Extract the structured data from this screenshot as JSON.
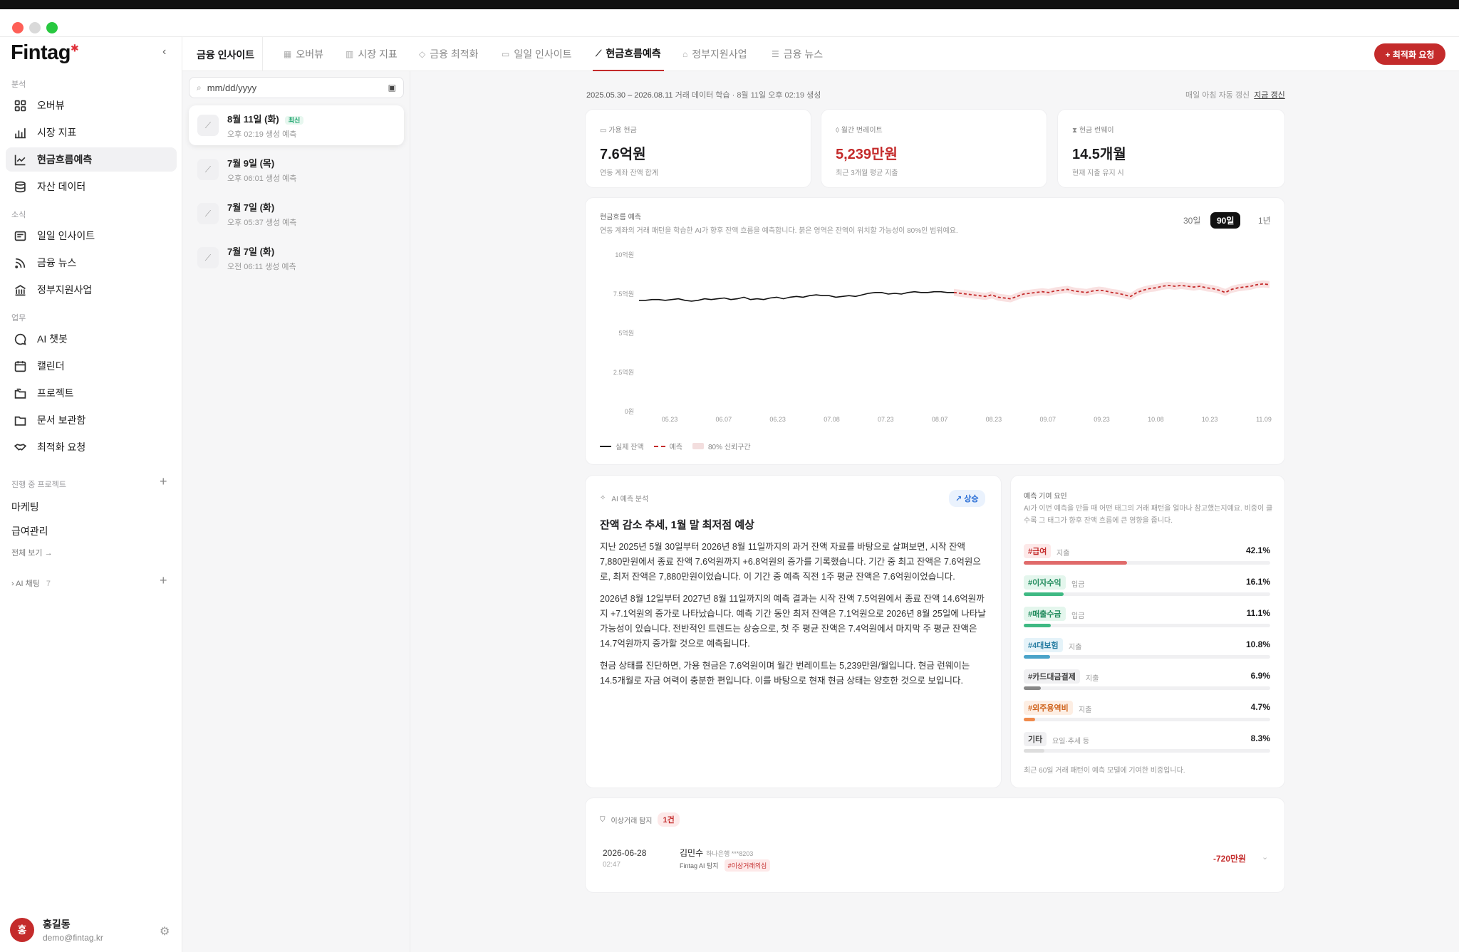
{
  "sidebar": {
    "logo": "Fintag",
    "sections": {
      "analysis": "분석",
      "news": "소식",
      "work": "업무",
      "projects": "진행 중 프로젝트"
    },
    "analysis_items": [
      "오버뷰",
      "시장 지표",
      "현금흐름예측",
      "자산 데이터"
    ],
    "news_items": [
      "일일 인사이트",
      "금융 뉴스",
      "정부지원사업"
    ],
    "work_items": [
      "AI 챗봇",
      "캘린더",
      "프로젝트",
      "문서 보관함",
      "최적화 요청"
    ],
    "projects": [
      "마케팅",
      "급여관리"
    ],
    "see_all": "전체 보기 →",
    "ai_chat": "AI 채팅",
    "ai_chat_count": "7",
    "user": {
      "initial": "홍",
      "name": "홍길동",
      "email": "demo@fintag.kr"
    }
  },
  "header": {
    "title": "금융 인사이트",
    "tabs": [
      "오버뷰",
      "시장 지표",
      "금융 최적화",
      "일일 인사이트",
      "현금흐름예측",
      "정부지원사업",
      "금융 뉴스"
    ],
    "active_tab": "현금흐름예측",
    "request_button": "+ 최적화 요청"
  },
  "reports": {
    "date_placeholder": "mm/dd/yyyy",
    "items": [
      {
        "title": "8월 11일 (화)",
        "sub": "오후 02:19 생성 예측",
        "badge": "최신"
      },
      {
        "title": "7월 9일 (목)",
        "sub": "오후 06:01 생성 예측"
      },
      {
        "title": "7월 7일 (화)",
        "sub": "오후 05:37 생성 예측"
      },
      {
        "title": "7월 7일 (화)",
        "sub": "오전 06:11 생성 예측"
      }
    ]
  },
  "meta": {
    "period": "2025.05.30 – 2026.08.11",
    "detail": " 거래 데이터 학습 · 8월 11일 오후 02:19 생성",
    "auto": "매일 아침 자동 갱신",
    "refresh": "지금 갱신"
  },
  "kpis": [
    {
      "label": "가용 현금",
      "value": "7.6억원",
      "sub": "연동 계좌 잔액 합계",
      "color": "#1c1c1e"
    },
    {
      "label": "월간 번레이트",
      "value": "5,239만원",
      "sub": "최근 3개월 평균 지출",
      "color": "#c42b2b"
    },
    {
      "label": "현금 런웨이",
      "value": "14.5개월",
      "sub": "현재 지출 유지 시",
      "color": "#1c1c1e"
    }
  ],
  "forecast": {
    "title": "현금흐름 예측",
    "desc": "연동 계좌의 거래 패턴을 학습한 AI가 향후 잔액 흐름을 예측합니다. 붉은 영역은 잔액이 위치할 가능성이 80%인 범위예요.",
    "ranges": [
      "30일",
      "90일",
      "1년"
    ],
    "active_range": "90일",
    "legend": [
      "실제 잔액",
      "예측",
      "80% 신뢰구간"
    ]
  },
  "chart_data": {
    "type": "line",
    "y_ticks": [
      "10억원",
      "7.5억원",
      "5억원",
      "2.5억원",
      "0원"
    ],
    "ylim": [
      0,
      10
    ],
    "x_ticks": [
      "05.23",
      "06.07",
      "06.23",
      "07.08",
      "07.23",
      "08.07",
      "08.23",
      "09.07",
      "09.23",
      "10.08",
      "10.23",
      "11.09"
    ],
    "series": [
      {
        "name": "실제 잔액",
        "values": [
          7.1,
          7.1,
          7.15,
          7.15,
          7.1,
          7.15,
          7.2,
          7.1,
          7.05,
          7.1,
          7.2,
          7.15,
          7.2,
          7.25,
          7.15,
          7.2,
          7.3,
          7.15,
          7.2,
          7.15,
          7.25,
          7.3,
          7.2,
          7.3,
          7.35,
          7.3,
          7.4,
          7.45,
          7.4,
          7.4,
          7.3,
          7.35,
          7.4,
          7.35,
          7.45,
          7.55,
          7.6,
          7.6,
          7.5,
          7.55,
          7.5,
          7.6,
          7.65,
          7.6,
          7.6,
          7.65,
          7.65,
          7.6,
          7.6
        ]
      },
      {
        "name": "예측",
        "values": [
          7.6,
          7.55,
          7.5,
          7.45,
          7.4,
          7.35,
          7.45,
          7.3,
          7.25,
          7.2,
          7.35,
          7.5,
          7.55,
          7.6,
          7.65,
          7.6,
          7.7,
          7.75,
          7.8,
          7.7,
          7.65,
          7.6,
          7.7,
          7.75,
          7.7,
          7.6,
          7.55,
          7.45,
          7.35,
          7.6,
          7.75,
          7.85,
          7.9,
          8.0,
          8.05,
          8.0,
          8.05,
          8.0,
          7.95,
          8.0,
          7.9,
          7.85,
          7.75,
          7.6,
          7.8,
          7.9,
          7.95,
          8.0,
          8.1,
          8.15,
          8.1
        ]
      }
    ]
  },
  "ai_analysis": {
    "label": "AI 예측 분석",
    "trend": "상승",
    "title": "잔액 감소 추세, 1월 말 최저점 예상",
    "paragraphs": [
      "지난 2025년 5월 30일부터 2026년 8월 11일까지의 과거 잔액 자료를 바탕으로 살펴보면, 시작 잔액 7,880만원에서 종료 잔액 7.6억원까지 +6.8억원의 증가를 기록했습니다. 기간 중 최고 잔액은 7.6억원으로, 최저 잔액은 7,880만원이었습니다. 이 기간 중 예측 직전 1주 평균 잔액은 7.6억원이었습니다.",
      "2026년 8월 12일부터 2027년 8월 11일까지의 예측 결과는 시작 잔액 7.5억원에서 종료 잔액 14.6억원까지 +7.1억원의 증가로 나타났습니다. 예측 기간 동안 최저 잔액은 7.1억원으로 2026년 8월 25일에 나타날 가능성이 있습니다. 전반적인 트렌드는 상승으로, 첫 주 평균 잔액은 7.4억원에서 마지막 주 평균 잔액은 14.7억원까지 증가할 것으로 예측됩니다.",
      "현금 상태를 진단하면, 가용 현금은 7.6억원이며 월간 번레이트는 5,239만원/월입니다. 현금 런웨이는 14.5개월로 자금 여력이 충분한 편입니다. 이를 바탕으로 현재 현금 상태는 양호한 것으로 보입니다."
    ]
  },
  "factors": {
    "title": "예측 기여 요인",
    "desc": "AI가 이번 예측을 만들 때 어떤 태그의 거래 패턴을 얼마나 참고했는지예요. 비중이 클수록 그 태그가 향후 잔액 흐름에 큰 영향을 줍니다.",
    "items": [
      {
        "tag": "#급여",
        "kind": "지출",
        "pct": "42.1%",
        "share": 0.421,
        "color": "#e06a6a",
        "tagbg": "#fde9e9",
        "tagfg": "#c42b2b"
      },
      {
        "tag": "#이자수익",
        "kind": "입금",
        "pct": "16.1%",
        "share": 0.161,
        "color": "#3fb983",
        "tagbg": "#e4f6ed",
        "tagfg": "#1f8a5b"
      },
      {
        "tag": "#매출수금",
        "kind": "입금",
        "pct": "11.1%",
        "share": 0.111,
        "color": "#3fb983",
        "tagbg": "#e4f6ed",
        "tagfg": "#1f8a5b"
      },
      {
        "tag": "#4대보험",
        "kind": "지출",
        "pct": "10.8%",
        "share": 0.108,
        "color": "#4aa3c9",
        "tagbg": "#e5f3f9",
        "tagfg": "#2a7fa3"
      },
      {
        "tag": "#카드대금결제",
        "kind": "지출",
        "pct": "6.9%",
        "share": 0.069,
        "color": "#888888",
        "tagbg": "#f0f0f2",
        "tagfg": "#444444"
      },
      {
        "tag": "#외주용역비",
        "kind": "지출",
        "pct": "4.7%",
        "share": 0.047,
        "color": "#f08a4b",
        "tagbg": "#fdeee3",
        "tagfg": "#d0651f"
      },
      {
        "tag": "기타",
        "kind": "요일·추세 등",
        "pct": "8.3%",
        "share": 0.083,
        "color": "#dddddd",
        "tagbg": "#f0f0f2",
        "tagfg": "#444444"
      }
    ],
    "footnote": "최근 60일 거래 패턴이 예측 모델에 기여한 비중입니다."
  },
  "anomaly": {
    "label": "이상거래 탐지",
    "count": "1건",
    "date": "2026-06-28",
    "time": "02:47",
    "name": "김민수",
    "bank": "하나은행 ***8203",
    "detector": "Fintag AI 탐지",
    "tag": "#이상거래의심",
    "amount": "-720만원"
  }
}
